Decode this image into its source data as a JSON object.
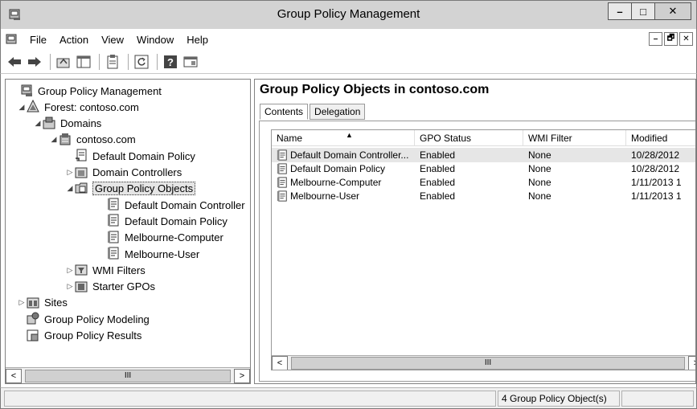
{
  "window": {
    "title": "Group Policy Management",
    "minimize": "–",
    "maximize": "□",
    "close": "✕"
  },
  "menu": {
    "items": [
      "File",
      "Action",
      "View",
      "Window",
      "Help"
    ],
    "mdi_min": "–",
    "mdi_restore": "🗗",
    "mdi_close": "✕"
  },
  "toolbar": {
    "icons": [
      "back-arrow-icon",
      "forward-arrow-icon",
      "up-folder-icon",
      "show-hide-tree-icon",
      "properties-icon",
      "refresh-icon",
      "help-icon",
      "console-tree-icon"
    ]
  },
  "tree": {
    "items": [
      {
        "label": "Group Policy Management",
        "depth": 0,
        "expander": "",
        "icon": "gpm-icon"
      },
      {
        "label": "Forest: contoso.com",
        "depth": 1,
        "expander": "◢",
        "icon": "forest-icon"
      },
      {
        "label": "Domains",
        "depth": 2,
        "expander": "◢",
        "icon": "domains-icon"
      },
      {
        "label": "contoso.com",
        "depth": 3,
        "expander": "◢",
        "icon": "domain-icon"
      },
      {
        "label": "Default Domain Policy",
        "depth": 4,
        "expander": "",
        "icon": "gpo-link-icon"
      },
      {
        "label": "Domain Controllers",
        "depth": 4,
        "expander": "▷",
        "icon": "ou-icon"
      },
      {
        "label": "Group Policy Objects",
        "depth": 4,
        "expander": "◢",
        "icon": "gpo-folder-icon",
        "selected": true
      },
      {
        "label": "Default Domain Controller",
        "depth": 5,
        "expander": "",
        "icon": "gpo-icon"
      },
      {
        "label": "Default Domain Policy",
        "depth": 5,
        "expander": "",
        "icon": "gpo-icon"
      },
      {
        "label": "Melbourne-Computer",
        "depth": 5,
        "expander": "",
        "icon": "gpo-icon"
      },
      {
        "label": "Melbourne-User",
        "depth": 5,
        "expander": "",
        "icon": "gpo-icon"
      },
      {
        "label": "WMI Filters",
        "depth": 4,
        "expander": "▷",
        "icon": "wmi-icon"
      },
      {
        "label": "Starter GPOs",
        "depth": 4,
        "expander": "▷",
        "icon": "starter-icon"
      },
      {
        "label": "Sites",
        "depth": 1,
        "expander": "▷",
        "icon": "sites-icon"
      },
      {
        "label": "Group Policy Modeling",
        "depth": 1,
        "expander": "",
        "icon": "modeling-icon"
      },
      {
        "label": "Group Policy Results",
        "depth": 1,
        "expander": "",
        "icon": "results-icon"
      }
    ],
    "scroll_left": "<",
    "scroll_right": ">",
    "scroll_grip": "III"
  },
  "main": {
    "title": "Group Policy Objects in contoso.com",
    "tabs": [
      "Contents",
      "Delegation"
    ],
    "columns": [
      "Name",
      "GPO Status",
      "WMI Filter",
      "Modified"
    ],
    "rows": [
      {
        "name": "Default Domain Controller...",
        "status": "Enabled",
        "wmi": "None",
        "modified": "10/28/2012"
      },
      {
        "name": "Default Domain Policy",
        "status": "Enabled",
        "wmi": "None",
        "modified": "10/28/2012"
      },
      {
        "name": "Melbourne-Computer",
        "status": "Enabled",
        "wmi": "None",
        "modified": "1/11/2013 1"
      },
      {
        "name": "Melbourne-User",
        "status": "Enabled",
        "wmi": "None",
        "modified": "1/11/2013 1"
      }
    ],
    "scroll_left": "<",
    "scroll_right": ">",
    "scroll_grip": "III",
    "sort_arrow": "▲"
  },
  "status": {
    "text": "4 Group Policy Object(s)"
  }
}
